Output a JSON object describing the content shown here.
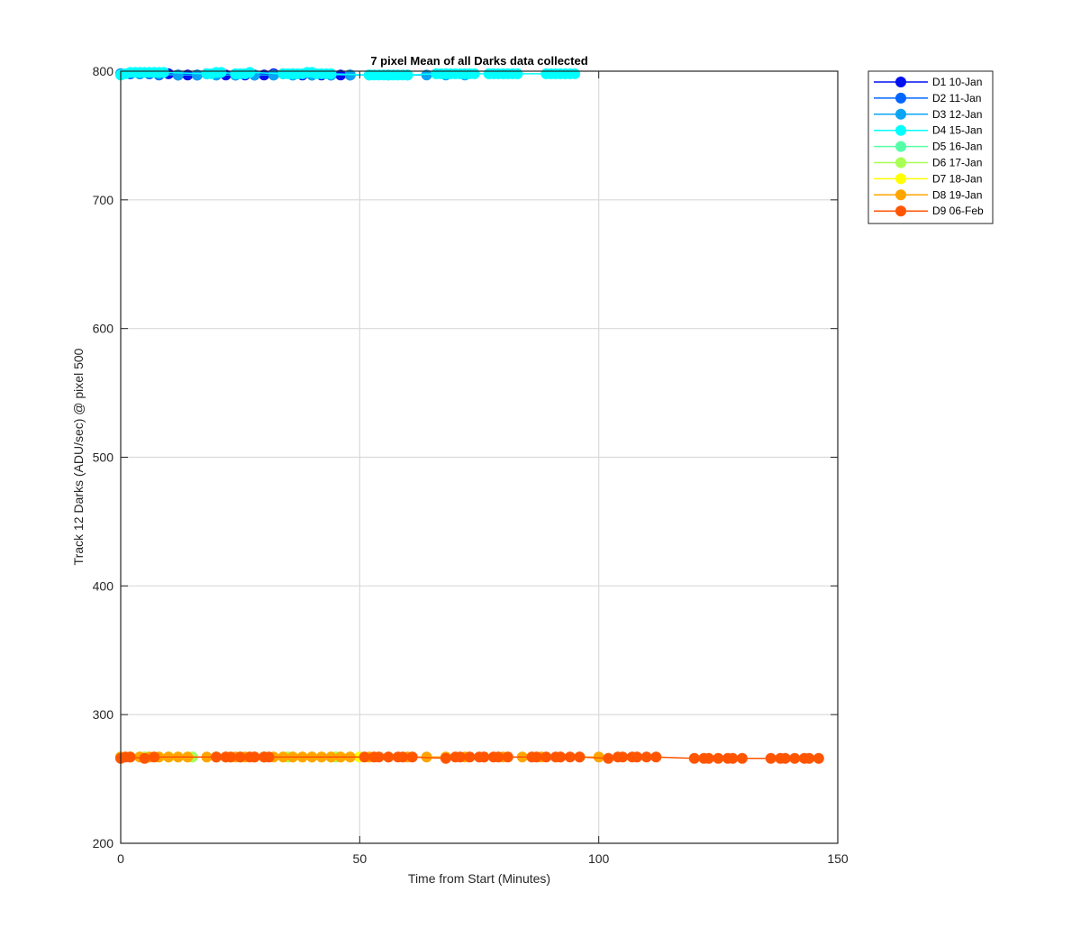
{
  "chart_data": {
    "type": "line",
    "title": "7 pixel Mean of all Darks data collected",
    "xlabel": "Time from Start (Minutes)",
    "ylabel": "Track 12 Darks (ADU/sec) @ pixel 500",
    "xlim": [
      0,
      150
    ],
    "ylim": [
      200,
      800
    ],
    "xticks": [
      0,
      50,
      100,
      150
    ],
    "yticks": [
      200,
      300,
      400,
      500,
      600,
      700,
      800
    ],
    "grid": true,
    "legend_position": "outside-top-right",
    "marker": "filled-circle",
    "series": [
      {
        "name": "D1 10-Jan",
        "color": "#0010F0",
        "x": [
          0,
          2,
          4,
          6,
          8,
          10,
          12,
          14,
          16,
          18,
          20,
          22,
          24,
          26,
          28,
          30,
          32,
          34,
          36,
          38,
          40,
          42,
          44,
          46,
          48
        ],
        "y": [
          798,
          798,
          798,
          798,
          798,
          798,
          797,
          797,
          797,
          798,
          798,
          797,
          797,
          797,
          797,
          797,
          798,
          798,
          798,
          797,
          797,
          797,
          797,
          797,
          797
        ]
      },
      {
        "name": "D2 11-Jan",
        "color": "#0066FF",
        "x": [
          0,
          2,
          4,
          6,
          8,
          12,
          16,
          20,
          24,
          28,
          32,
          36,
          40,
          44,
          48
        ],
        "y": [
          798,
          798,
          798,
          798,
          797,
          797,
          797,
          797,
          797,
          797,
          797,
          797,
          797,
          797,
          797
        ]
      },
      {
        "name": "D3 12-Jan",
        "color": "#0AA4F4",
        "x": [
          0,
          4,
          8,
          12,
          16,
          20,
          24,
          28,
          32,
          36,
          40,
          44,
          48,
          52,
          56,
          60,
          64,
          68,
          72
        ],
        "y": [
          798,
          798,
          798,
          797,
          797,
          797,
          797,
          797,
          797,
          797,
          797,
          797,
          797,
          797,
          797,
          797,
          797,
          797,
          797
        ]
      },
      {
        "name": "D4 15-Jan",
        "color": "#00FFFF",
        "x": [
          0,
          1,
          2,
          3,
          4,
          5,
          6,
          7,
          8,
          9,
          18,
          19,
          20,
          21,
          24,
          25,
          26,
          27,
          34,
          35,
          36,
          37,
          38,
          39,
          40,
          41,
          42,
          43,
          44,
          52,
          53,
          54,
          55,
          56,
          57,
          58,
          59,
          60,
          66,
          67,
          68,
          69,
          70,
          71,
          72,
          73,
          74,
          77,
          78,
          79,
          80,
          81,
          82,
          83,
          89,
          90,
          91,
          92,
          93,
          94,
          95
        ],
        "y": [
          797,
          798,
          799,
          799,
          799,
          799,
          799,
          799,
          799,
          799,
          798,
          798,
          799,
          799,
          798,
          798,
          798,
          799,
          798,
          798,
          798,
          798,
          798,
          799,
          799,
          798,
          798,
          798,
          798,
          797,
          797,
          797,
          797,
          797,
          797,
          797,
          797,
          797,
          798,
          798,
          798,
          798,
          798,
          798,
          798,
          798,
          798,
          798,
          798,
          798,
          798,
          798,
          798,
          798,
          798,
          798,
          798,
          798,
          798,
          798,
          798
        ]
      },
      {
        "name": "D5 16-Jan",
        "color": "#55FFA8",
        "x": [
          0,
          5,
          10,
          15,
          20,
          25,
          30,
          35,
          40,
          45,
          50
        ],
        "y": [
          267,
          267,
          267,
          267,
          267,
          267,
          267,
          267,
          267,
          267,
          267
        ]
      },
      {
        "name": "D6 17-Jan",
        "color": "#A8FF55",
        "x": [
          0,
          5,
          10,
          15,
          20,
          25,
          30,
          35,
          40,
          45,
          50
        ],
        "y": [
          267,
          267,
          267,
          267,
          267,
          267,
          267,
          267,
          267,
          267,
          267
        ]
      },
      {
        "name": "D7 18-Jan",
        "color": "#FFFF00",
        "x": [
          0,
          2,
          4,
          6,
          8,
          10,
          12,
          14,
          34,
          36,
          38,
          40,
          42,
          44,
          46,
          48,
          50
        ],
        "y": [
          267,
          267,
          267,
          267,
          267,
          267,
          267,
          267,
          267,
          267,
          267,
          267,
          267,
          267,
          267,
          267,
          267
        ]
      },
      {
        "name": "D8 19-Jan",
        "color": "#FFA500",
        "x": [
          0,
          2,
          4,
          6,
          8,
          10,
          12,
          14,
          18,
          20,
          22,
          24,
          26,
          28,
          30,
          32,
          34,
          36,
          38,
          40,
          42,
          44,
          46,
          48,
          52,
          56,
          60,
          64,
          68,
          72,
          76,
          80,
          84,
          88,
          92,
          96,
          100
        ],
        "y": [
          267,
          267,
          267,
          267,
          267,
          267,
          267,
          267,
          267,
          267,
          267,
          267,
          267,
          267,
          267,
          267,
          267,
          267,
          267,
          267,
          267,
          267,
          267,
          267,
          267,
          267,
          267,
          267,
          267,
          267,
          267,
          267,
          267,
          267,
          267,
          267,
          267
        ]
      },
      {
        "name": "D9 06-Feb",
        "color": "#FF5500",
        "x": [
          0,
          1,
          2,
          5,
          7,
          20,
          22,
          23,
          25,
          27,
          28,
          30,
          31,
          51,
          53,
          54,
          56,
          58,
          59,
          61,
          68,
          70,
          71,
          73,
          75,
          76,
          78,
          79,
          81,
          86,
          87,
          89,
          91,
          92,
          94,
          96,
          102,
          104,
          105,
          107,
          108,
          110,
          112,
          120,
          122,
          123,
          125,
          127,
          128,
          130,
          136,
          138,
          139,
          141,
          143,
          144,
          146
        ],
        "y": [
          266,
          267,
          267,
          266,
          267,
          267,
          267,
          267,
          267,
          267,
          267,
          267,
          267,
          267,
          267,
          267,
          267,
          267,
          267,
          267,
          266,
          267,
          267,
          267,
          267,
          267,
          267,
          267,
          267,
          267,
          267,
          267,
          267,
          267,
          267,
          267,
          266,
          267,
          267,
          267,
          267,
          267,
          267,
          266,
          266,
          266,
          266,
          266,
          266,
          266,
          266,
          266,
          266,
          266,
          266,
          266,
          266
        ]
      }
    ]
  }
}
